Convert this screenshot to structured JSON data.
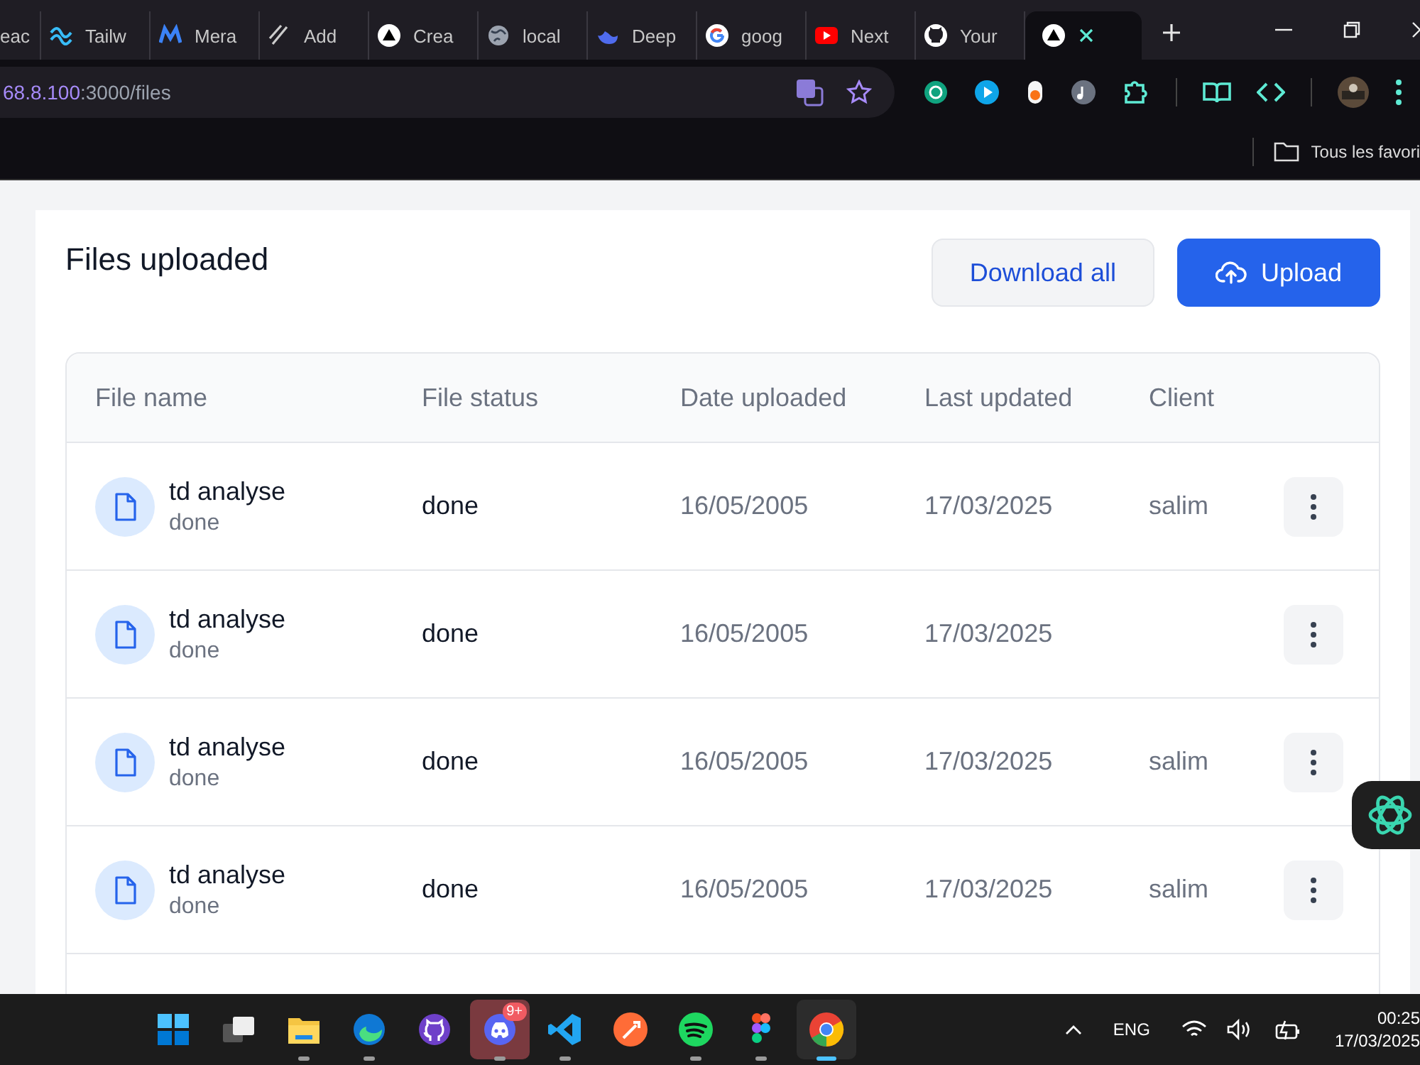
{
  "browser": {
    "tabs": [
      {
        "title": "eac",
        "kind": "none",
        "selected": false
      },
      {
        "title": "Tailw",
        "kind": "waves",
        "selected": false
      },
      {
        "title": "Mera",
        "kind": "m",
        "selected": false
      },
      {
        "title": "Add",
        "kind": "slash",
        "selected": false
      },
      {
        "title": "Crea",
        "kind": "triangle",
        "selected": false
      },
      {
        "title": "local",
        "kind": "globe",
        "selected": false
      },
      {
        "title": "Deep",
        "kind": "whale",
        "selected": false
      },
      {
        "title": "goog",
        "kind": "g",
        "selected": false
      },
      {
        "title": "Next",
        "kind": "play",
        "selected": false
      },
      {
        "title": "Your",
        "kind": "cat",
        "selected": false
      },
      {
        "kind": "triangle",
        "selected": true
      }
    ],
    "address": {
      "host": "68.8.100",
      "path": ":3000/files"
    },
    "bookmarks_bar": {
      "label": "Tous les favori"
    }
  },
  "page": {
    "title": "Files uploaded",
    "buttons": [
      {
        "label": "Download all",
        "kind": "secondary"
      },
      {
        "label": "Upload",
        "kind": "primary"
      }
    ],
    "table": {
      "columns": [
        "File name",
        "File status",
        "Date uploaded",
        "Last updated",
        "Client"
      ],
      "rows": [
        {
          "name": "td analyse",
          "subtitle": "done",
          "status": "done",
          "date_uploaded": "16/05/2005",
          "last_updated": "17/03/2025",
          "client": "salim"
        },
        {
          "name": "td analyse",
          "subtitle": "done",
          "status": "done",
          "date_uploaded": "16/05/2005",
          "last_updated": "17/03/2025"
        },
        {
          "name": "td analyse",
          "subtitle": "done",
          "status": "done",
          "date_uploaded": "16/05/2005",
          "last_updated": "17/03/2025",
          "client": "salim"
        },
        {
          "name": "td analyse",
          "subtitle": "done",
          "status": "done",
          "date_uploaded": "16/05/2005",
          "last_updated": "17/03/2025",
          "client": "salim"
        }
      ]
    }
  },
  "taskbar": {
    "apps": [
      {
        "kind": "start",
        "running": false,
        "active": false
      },
      {
        "kind": "taskview",
        "running": false,
        "active": false
      },
      {
        "kind": "files",
        "running": true,
        "active": false
      },
      {
        "kind": "edge",
        "running": true,
        "active": false
      },
      {
        "kind": "github",
        "running": false,
        "active": false
      },
      {
        "kind": "discord",
        "running": true,
        "active": false,
        "badge": "9+"
      },
      {
        "kind": "vscode",
        "running": true,
        "active": false
      },
      {
        "kind": "postman",
        "running": false,
        "active": false
      },
      {
        "kind": "spotify",
        "running": true,
        "active": false
      },
      {
        "kind": "figma",
        "running": true,
        "active": false
      },
      {
        "kind": "chrome",
        "running": true,
        "active": true
      }
    ],
    "language": "ENG",
    "time": "00:25",
    "date": "17/03/2025"
  }
}
